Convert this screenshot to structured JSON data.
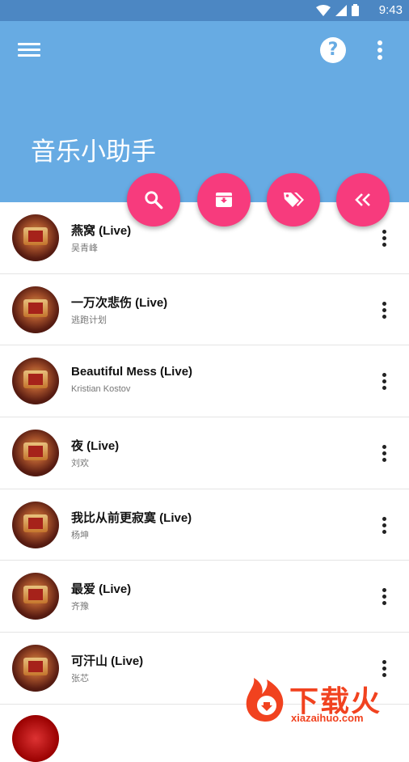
{
  "status_bar": {
    "time": "9:43"
  },
  "app_bar": {
    "title": "音乐小助手",
    "background": "#67abe3",
    "menu_icon": "menu-icon",
    "help_icon": "help-icon",
    "more_icon": "more-vert-icon"
  },
  "fabs": [
    {
      "name": "search",
      "icon": "search-icon"
    },
    {
      "name": "archive",
      "icon": "archive-icon"
    },
    {
      "name": "tags",
      "icon": "tags-icon"
    },
    {
      "name": "collapse",
      "icon": "double-chevron-left-icon"
    }
  ],
  "fab_color": "#f73b7d",
  "songs": [
    {
      "title": "燕窝 (Live)",
      "artist": "吴青峰"
    },
    {
      "title": "一万次悲伤 (Live)",
      "artist": "逃跑计划"
    },
    {
      "title": "Beautiful Mess (Live)",
      "artist": "Kristian Kostov"
    },
    {
      "title": "夜 (Live)",
      "artist": "刘欢"
    },
    {
      "title": "我比从前更寂寞 (Live)",
      "artist": "杨坤"
    },
    {
      "title": "最爱 (Live)",
      "artist": "齐豫"
    },
    {
      "title": "可汗山 (Live)",
      "artist": "张芯"
    }
  ],
  "watermark": {
    "text": "下载火",
    "url": "xiazaihuo.com"
  }
}
